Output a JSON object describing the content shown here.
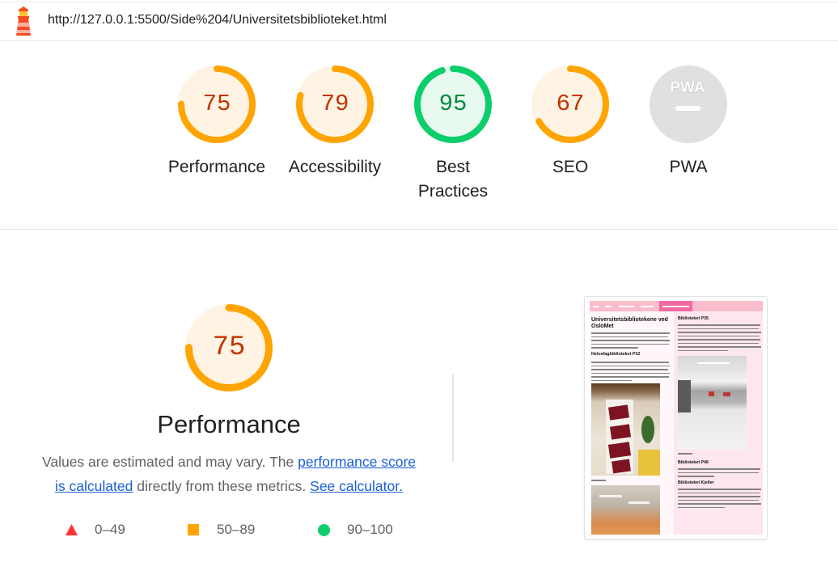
{
  "browser": {
    "url": "http://127.0.0.1:5500/Side%204/Universitetsbiblioteket.html",
    "icon": "lighthouse-icon"
  },
  "colors": {
    "pass": "#0cce6b",
    "pass_bg": "#e8f9ef",
    "pass_text": "#008a3e",
    "average": "#ffa400",
    "average_bg": "#fff4e3",
    "average_text": "#c33300",
    "fail": "#ff3333",
    "fail_bg": "#ffeaea",
    "fail_text": "#cc0000",
    "not_applicable": "#e0e0e0",
    "link": "#1a5fd6"
  },
  "categories": [
    {
      "label": "Performance",
      "score": 75
    },
    {
      "label": "Accessibility",
      "score": 79
    },
    {
      "label": "Best Practices",
      "score": 95
    },
    {
      "label": "SEO",
      "score": 67
    },
    {
      "label": "PWA",
      "badge": "PWA",
      "badge_icon": "pwa-badge-icon"
    }
  ],
  "performance": {
    "score": 75,
    "title": "Performance",
    "description": {
      "before": "Values are estimated and may vary. The ",
      "score_link_line1": "performance score",
      "score_link_line2": "is calculated",
      "middle": " directly from these metrics. ",
      "calculator_link": "See calculator."
    }
  },
  "legend": [
    {
      "icon": "fail-triangle-icon",
      "range": "0–49"
    },
    {
      "icon": "average-square-icon",
      "range": "50–89"
    },
    {
      "icon": "pass-circle-icon",
      "range": "90–100"
    }
  ],
  "final_screenshot": {
    "headings": {
      "page_title": "Universitetsbibliotekene ved OsloMet",
      "p32": "Helsefagbiblioteket P32",
      "p35": "Biblioteket P35",
      "p46": "Biblioteket P46",
      "kjeller": "Biblioteket Kjeller"
    },
    "colors": {
      "nav": "#f8bccb",
      "nav_active": "#f06aa2",
      "page_bg": "#fde7ed"
    }
  }
}
